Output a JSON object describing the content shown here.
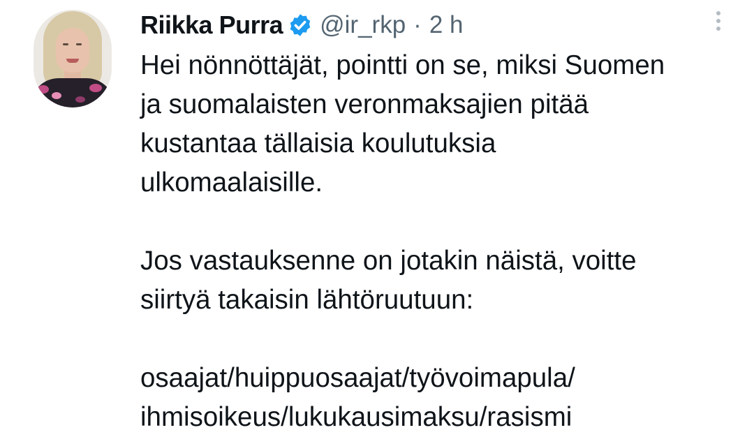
{
  "tweet": {
    "author": {
      "name": "Riikka Purra",
      "handle": "@ir_rkp",
      "verified": true,
      "verified_color": "#1d9bf0"
    },
    "separator": "·",
    "time": "2 h",
    "more_icon": "more-vertical-icon",
    "paragraphs": [
      {
        "lines": [
          "Hei nönnöttäjät, pointti on se, miksi Suomen",
          "ja suomalaisten veronmaksajien pitää",
          "kustantaa tällaisia koulutuksia",
          "ulkomaalaisille."
        ]
      },
      {
        "lines": [
          "Jos vastauksenne on jotakin näistä, voitte",
          "siirtyä takaisin lähtöruutuun:"
        ]
      },
      {
        "lines": [
          "osaajat/huippuosaajat/työvoimapula/",
          "ihmisoikeus/lukukausimaksu/rasismi"
        ]
      }
    ]
  }
}
